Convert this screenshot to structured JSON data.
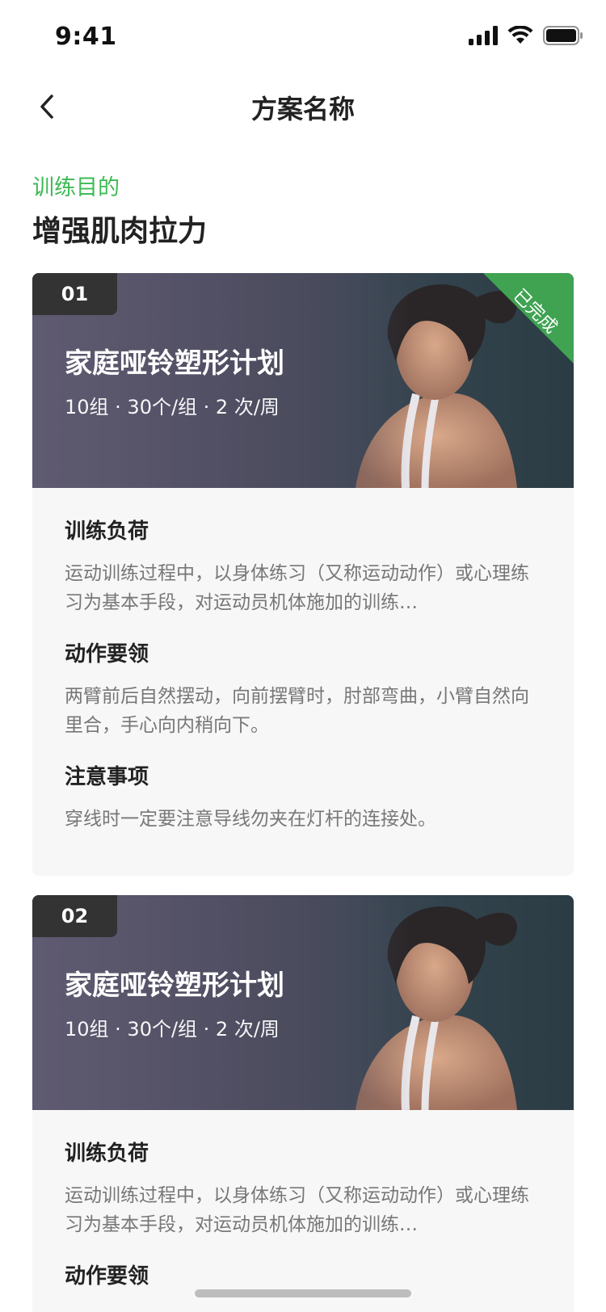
{
  "status_bar": {
    "time": "9:41"
  },
  "nav": {
    "title": "方案名称"
  },
  "goal": {
    "label": "训练目的",
    "value": "增强肌肉拉力"
  },
  "accent": "#3dba54",
  "plans": [
    {
      "index": "01",
      "title": "家庭哑铃塑形计划",
      "meta": "10组 · 30个/组 · 2 次/周",
      "status": "已完成",
      "sections": [
        {
          "title": "训练负荷",
          "text": "运动训练过程中，以身体练习（又称运动动作）或心理练习为基本手段，对运动员机体施加的训练…"
        },
        {
          "title": "动作要领",
          "text": "两臂前后自然摆动，向前摆臂时，肘部弯曲，小臂自然向里合，手心向内稍向下。"
        },
        {
          "title": "注意事项",
          "text": "穿线时一定要注意导线勿夹在灯杆的连接处。"
        }
      ]
    },
    {
      "index": "02",
      "title": "家庭哑铃塑形计划",
      "meta": "10组 · 30个/组 · 2 次/周",
      "sections": [
        {
          "title": "训练负荷",
          "text": "运动训练过程中，以身体练习（又称运动动作）或心理练习为基本手段，对运动员机体施加的训练…"
        },
        {
          "title": "动作要领",
          "text": ""
        }
      ]
    }
  ]
}
